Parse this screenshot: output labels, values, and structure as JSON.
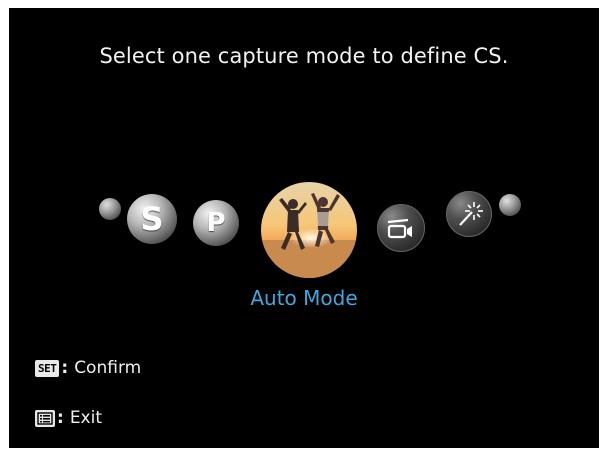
{
  "screen": {
    "title": "Select one capture mode to define CS.",
    "carousel": {
      "modes": [
        {
          "name": "end-left",
          "letter": ""
        },
        {
          "name": "shutter-priority",
          "letter": "S"
        },
        {
          "name": "program",
          "letter": "P"
        },
        {
          "name": "auto",
          "letter": ""
        },
        {
          "name": "movie",
          "letter": ""
        },
        {
          "name": "special-effects",
          "letter": ""
        },
        {
          "name": "end-right",
          "letter": ""
        }
      ],
      "selected_label": "Auto Mode"
    },
    "hints": {
      "confirm_key": "SET",
      "confirm_label": "Confirm",
      "exit_label": "Exit",
      "separator": ":"
    }
  },
  "colors": {
    "background": "#000000",
    "accent": "#3fa8dc",
    "text": "#f2f2f2"
  }
}
